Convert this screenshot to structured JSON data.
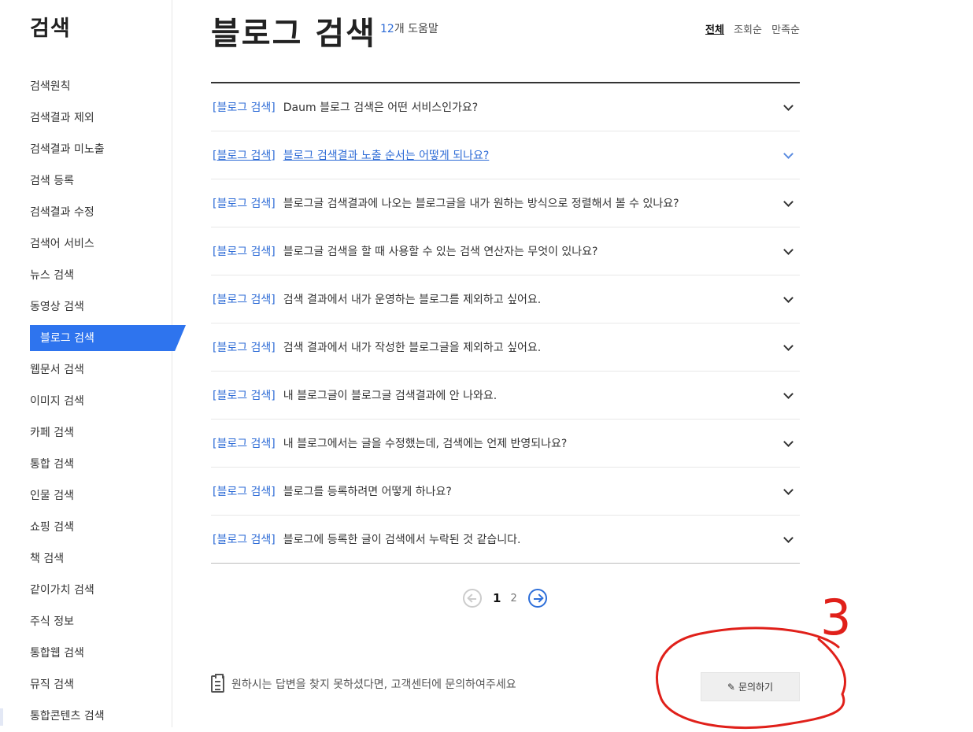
{
  "sidebar": {
    "title": "검색",
    "items": [
      {
        "label": "검색원칙"
      },
      {
        "label": "검색결과 제외"
      },
      {
        "label": "검색결과 미노출"
      },
      {
        "label": "검색 등록"
      },
      {
        "label": "검색결과 수정"
      },
      {
        "label": "검색어 서비스"
      },
      {
        "label": "뉴스 검색"
      },
      {
        "label": "동영상 검색"
      },
      {
        "label": "블로그 검색"
      },
      {
        "label": "웹문서 검색"
      },
      {
        "label": "이미지 검색"
      },
      {
        "label": "카페 검색"
      },
      {
        "label": "통합 검색"
      },
      {
        "label": "인물 검색"
      },
      {
        "label": "쇼핑 검색"
      },
      {
        "label": "책 검색"
      },
      {
        "label": "같이가치 검색"
      },
      {
        "label": "주식 정보"
      },
      {
        "label": "통합웹 검색"
      },
      {
        "label": "뮤직 검색"
      },
      {
        "label": "통합콘텐츠 검색"
      }
    ],
    "active_label": "블로그 검색"
  },
  "header": {
    "title": "블로그 검색",
    "help_count_number": "12",
    "help_count_suffix": "개 도움말",
    "sort": [
      "전체",
      "조회순",
      "만족순"
    ]
  },
  "faq": [
    {
      "category": "[블로그 검색]",
      "question": "Daum 블로그 검색은 어떤 서비스인가요?"
    },
    {
      "category": "[블로그 검색]",
      "question": "블로그 검색결과 노출 순서는 어떻게 되나요?"
    },
    {
      "category": "[블로그 검색]",
      "question": "블로그글 검색결과에 나오는 블로그글을 내가 원하는 방식으로 정렬해서 볼 수 있나요?"
    },
    {
      "category": "[블로그 검색]",
      "question": "블로그글 검색을 할 때 사용할 수 있는 검색 연산자는 무엇이 있나요?"
    },
    {
      "category": "[블로그 검색]",
      "question": "검색 결과에서 내가 운영하는 블로그를 제외하고 싶어요."
    },
    {
      "category": "[블로그 검색]",
      "question": "검색 결과에서 내가 작성한 블로그글을 제외하고 싶어요."
    },
    {
      "category": "[블로그 검색]",
      "question": "내 블로그글이 블로그글 검색결과에 안 나와요."
    },
    {
      "category": "[블로그 검색]",
      "question": "내 블로그에서는 글을 수정했는데, 검색에는 언제 반영되나요?"
    },
    {
      "category": "[블로그 검색]",
      "question": "블로그를 등록하려면 어떻게 하나요?"
    },
    {
      "category": "[블로그 검색]",
      "question": "블로그에 등록한 글이 검색에서 누락된 것 같습니다."
    }
  ],
  "pagination": {
    "current": "1",
    "other": "2"
  },
  "footer": {
    "notice": "원하시는 답변을 찾지 못하셨다면, 고객센터에 문의하여주세요",
    "ask_button": "문의하기"
  },
  "annotation": {
    "label": "3",
    "color": "#e0201a"
  },
  "colors": {
    "accent": "#2e74ee",
    "link": "#2d6bd6"
  }
}
